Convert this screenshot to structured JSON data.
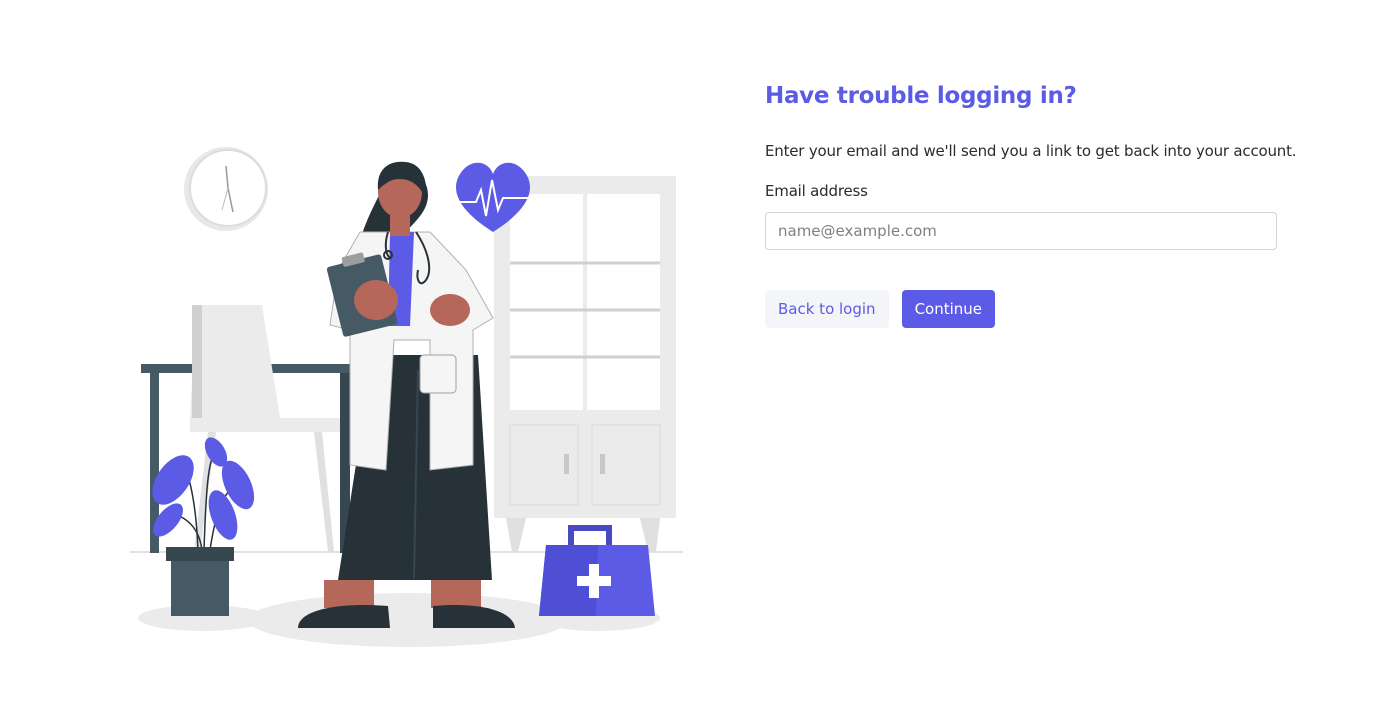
{
  "form": {
    "title": "Have trouble logging in?",
    "description": "Enter your email and we'll send you a link to get back into your account.",
    "email_label": "Email address",
    "email_placeholder": "name@example.com",
    "email_value": "",
    "back_label": "Back to login",
    "continue_label": "Continue"
  },
  "colors": {
    "accent": "#5b5be6",
    "button_secondary_bg": "#f4f5f8",
    "input_border": "#cfd4da"
  },
  "illustration": {
    "subject": "doctor-illustration",
    "icons": [
      "clock-icon",
      "heart-rate-icon",
      "medical-kit-icon",
      "plant-icon"
    ]
  }
}
